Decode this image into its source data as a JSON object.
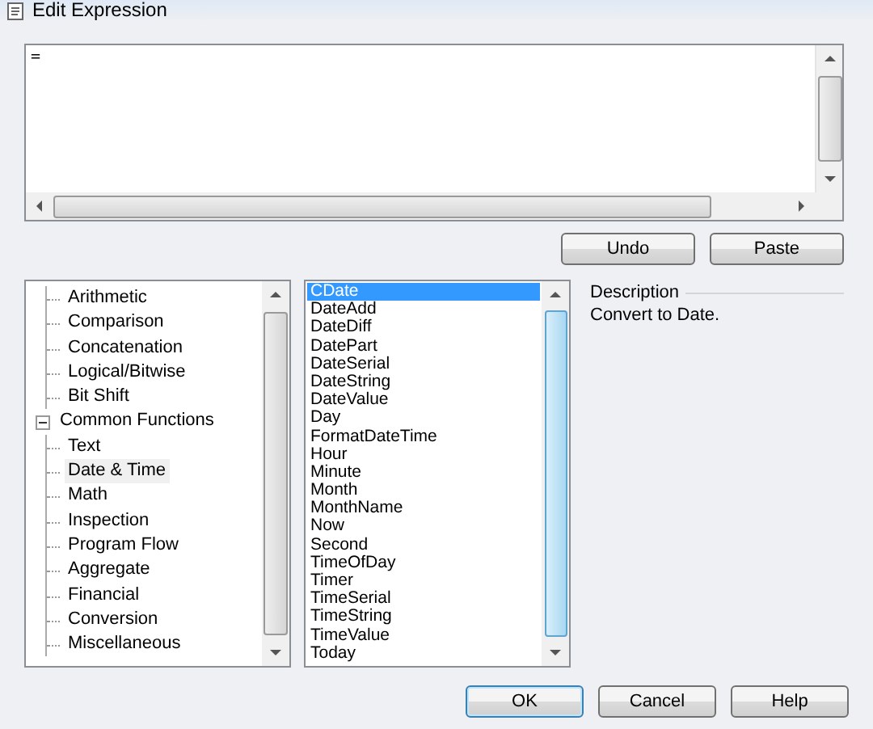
{
  "window": {
    "title": "Edit Expression"
  },
  "editor": {
    "value": "="
  },
  "edit_buttons": [
    "Undo",
    "Paste"
  ],
  "tree": {
    "continued_items": [
      {
        "label": "Arithmetic",
        "selected": false
      },
      {
        "label": "Comparison",
        "selected": false
      },
      {
        "label": "Concatenation",
        "selected": false
      },
      {
        "label": "Logical/Bitwise",
        "selected": false
      },
      {
        "label": "Bit Shift",
        "selected": false
      }
    ],
    "nodes": [
      {
        "label": "Common Functions",
        "expanded": true,
        "selected": false,
        "children": [
          {
            "label": "Text",
            "selected": false
          },
          {
            "label": "Date & Time",
            "selected": true
          },
          {
            "label": "Math",
            "selected": false
          },
          {
            "label": "Inspection",
            "selected": false
          },
          {
            "label": "Program Flow",
            "selected": false
          },
          {
            "label": "Aggregate",
            "selected": false
          },
          {
            "label": "Financial",
            "selected": false
          },
          {
            "label": "Conversion",
            "selected": false
          },
          {
            "label": "Miscellaneous",
            "selected": false
          }
        ]
      }
    ]
  },
  "functions": [
    {
      "label": "CDate",
      "selected": true
    },
    {
      "label": "DateAdd",
      "selected": false
    },
    {
      "label": "DateDiff",
      "selected": false
    },
    {
      "label": "DatePart",
      "selected": false
    },
    {
      "label": "DateSerial",
      "selected": false
    },
    {
      "label": "DateString",
      "selected": false
    },
    {
      "label": "DateValue",
      "selected": false
    },
    {
      "label": "Day",
      "selected": false
    },
    {
      "label": "FormatDateTime",
      "selected": false
    },
    {
      "label": "Hour",
      "selected": false
    },
    {
      "label": "Minute",
      "selected": false
    },
    {
      "label": "Month",
      "selected": false
    },
    {
      "label": "MonthName",
      "selected": false
    },
    {
      "label": "Now",
      "selected": false
    },
    {
      "label": "Second",
      "selected": false
    },
    {
      "label": "TimeOfDay",
      "selected": false
    },
    {
      "label": "Timer",
      "selected": false
    },
    {
      "label": "TimeSerial",
      "selected": false
    },
    {
      "label": "TimeString",
      "selected": false
    },
    {
      "label": "TimeValue",
      "selected": false
    },
    {
      "label": "Today",
      "selected": false
    }
  ],
  "description": {
    "heading": "Description",
    "text": "Convert to Date."
  },
  "dialog_buttons": [
    {
      "label": "OK",
      "default": true
    },
    {
      "label": "Cancel",
      "default": false
    },
    {
      "label": "Help",
      "default": false
    }
  ]
}
